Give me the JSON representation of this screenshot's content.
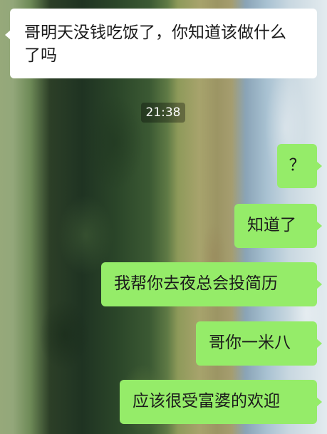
{
  "chat": {
    "time_divider": "21:38",
    "messages": [
      {
        "side": "incoming",
        "text": "哥明天没钱吃饭了，你知道该做什么了吗"
      },
      {
        "side": "outgoing",
        "text": "？"
      },
      {
        "side": "outgoing",
        "text": "知道了"
      },
      {
        "side": "outgoing",
        "text": "我帮你去夜总会投简历"
      },
      {
        "side": "outgoing",
        "text": "哥你一米八"
      },
      {
        "side": "outgoing",
        "text": "应该很受富婆的欢迎"
      }
    ]
  },
  "colors": {
    "incoming_bubble": "#ffffff",
    "outgoing_bubble": "#95ec69",
    "text": "#1b1b1b"
  }
}
